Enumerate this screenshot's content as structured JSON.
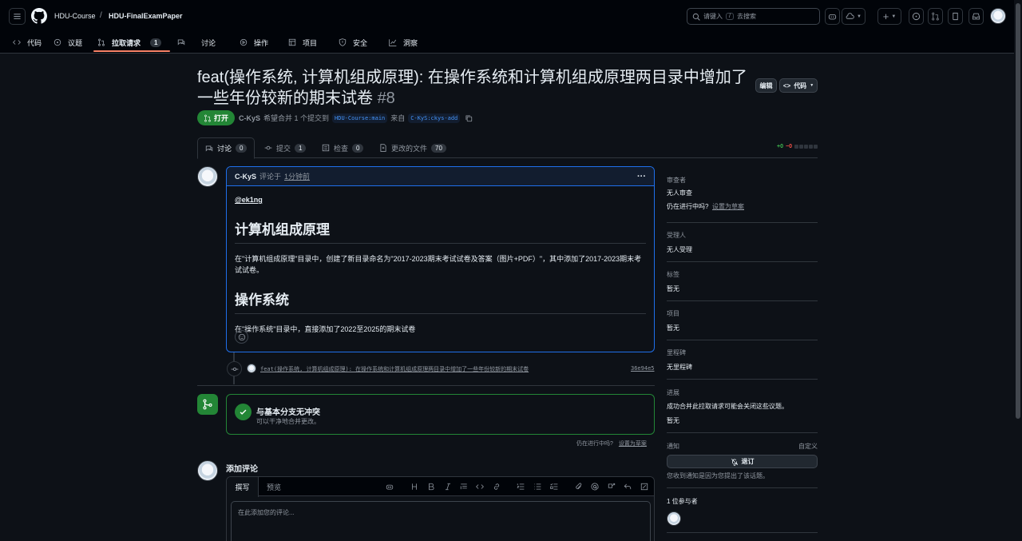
{
  "header": {
    "owner": "HDU-Course",
    "separator": "/",
    "repo": "HDU-FinalExamPaper",
    "search_placeholder_before": "请键入",
    "search_key": "/",
    "search_placeholder_after": "去搜索",
    "plus_label": "+"
  },
  "repo_nav": {
    "tabs": [
      {
        "label": "代码",
        "icon": "code-icon"
      },
      {
        "label": "议题",
        "icon": "issue-icon"
      },
      {
        "label": "拉取请求",
        "icon": "pull-request-icon",
        "count": "1",
        "active": true
      },
      {
        "label": "讨论",
        "icon": "discussion-icon"
      },
      {
        "label": "操作",
        "icon": "play-icon"
      },
      {
        "label": "项目",
        "icon": "table-icon"
      },
      {
        "label": "安全",
        "icon": "shield-icon"
      },
      {
        "label": "洞察",
        "icon": "graph-icon"
      }
    ]
  },
  "pr": {
    "title": "feat(操作系统, 计算机组成原理): 在操作系统和计算机组成原理两目录中增加了一些年份较新的期末试卷",
    "number": "#8",
    "state": "打开",
    "author": "C-KyS",
    "meta_wants": "希望合并 1 个提交到",
    "base_branch": "HDU-Course:main",
    "meta_from": "来自",
    "head_branch": "C-KyS:ckys-add",
    "edit_label": "编辑",
    "code_label": "代码"
  },
  "pr_tabs": [
    {
      "label": "讨论",
      "count": "0",
      "active": true,
      "icon": "discussion-icon"
    },
    {
      "label": "提交",
      "count": "1",
      "icon": "commit-icon"
    },
    {
      "label": "检查",
      "count": "0",
      "icon": "checklist-icon"
    },
    {
      "label": "更改的文件",
      "count": "70",
      "icon": "file-diff-icon"
    }
  ],
  "diffstat": {
    "added": "+0",
    "removed": "−0"
  },
  "comment": {
    "author": "C-KyS",
    "action": "评论于",
    "time": "1分钟前",
    "menu": "···",
    "mention": "@ek1ng",
    "h1_a": "计算机组成原理",
    "p_a": "在\"计算机组成原理\"目录中，创建了新目录命名为\"2017-2023期末考试试卷及答案（图片+PDF）\"，其中添加了2017-2023期末考试试卷。",
    "h1_b": "操作系统",
    "p_b": "在\"操作系统\"目录中，直接添加了2022至2025的期末试卷"
  },
  "commit": {
    "message": "feat(操作系统, 计算机组成原理): 在操作系统和计算机组成原理两目录中增加了一些年份较新的期末试卷",
    "sha": "36e94e5"
  },
  "merge": {
    "title": "与基本分支无冲突",
    "subtitle": "可以干净地合并更改。",
    "draft_q": "仍在进行中吗?",
    "draft_link": "设置为草案"
  },
  "add_comment": {
    "title": "添加评论",
    "tab_write": "撰写",
    "tab_preview": "预览",
    "placeholder": "在此添加您的评论..."
  },
  "sidebar": {
    "reviewers_label": "审查者",
    "reviewers_value": "无人审查",
    "wip_q": "仍在进行中吗?",
    "wip_link": "设置为草案",
    "assignees_label": "受理人",
    "assignees_value": "无人受理",
    "labels_label": "标签",
    "labels_value": "暂无",
    "projects_label": "项目",
    "projects_value": "暂无",
    "milestone_label": "里程碑",
    "milestone_value": "无里程碑",
    "development_label": "进展",
    "development_desc": "成功合并此拉取请求可能会关闭这些议题。",
    "development_value": "暂无",
    "notifications_label": "通知",
    "customize": "自定义",
    "unsubscribe": "退订",
    "notif_reason": "您收到通知是因为您提出了该话题。",
    "participants": "1 位参与者"
  },
  "colors": {
    "background": "#0d1117",
    "header": "#010409",
    "accent_green": "#238636",
    "accent_blue": "#1f6feb",
    "tab_underline": "#f78166"
  }
}
